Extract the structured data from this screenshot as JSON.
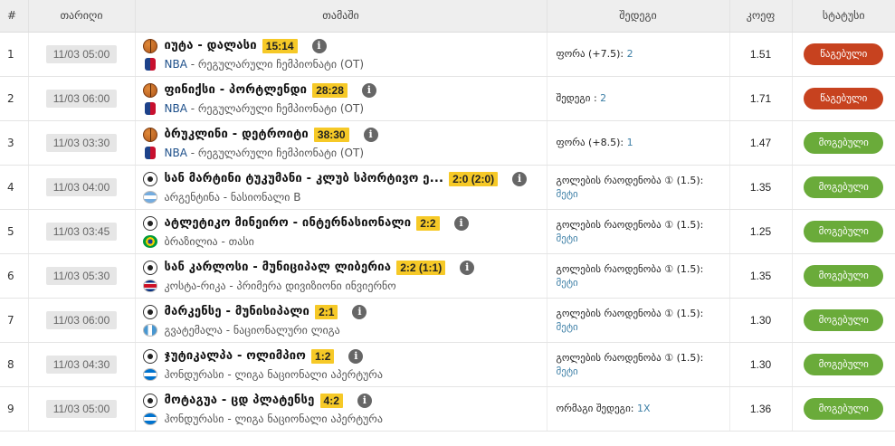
{
  "header": {
    "num": "#",
    "date": "თარიღი",
    "match": "თამაში",
    "result": "შედეგი",
    "coef": "კოეფ",
    "status": "სტატუსი"
  },
  "rows": [
    {
      "num": "1",
      "date": "11/03 05:00",
      "sport": "basketball",
      "teams": "იუტა - დალასი",
      "score": "15:14",
      "flag": "nba",
      "league_prefix": "NBA",
      "league": " - რეგულარული ჩემპიონატი (OT)",
      "result_label": "ფორა (+7.5): ",
      "result_value": "2",
      "result_label2": "",
      "coef": "1.51",
      "status": "წაგებული",
      "status_type": "lost"
    },
    {
      "num": "2",
      "date": "11/03 06:00",
      "sport": "basketball",
      "teams": "ფინიქსი - პორტლენდი",
      "score": "28:28",
      "flag": "nba",
      "league_prefix": "NBA",
      "league": " - რეგულარული ჩემპიონატი (OT)",
      "result_label": "შედეგი : ",
      "result_value": "2",
      "result_label2": "",
      "coef": "1.71",
      "status": "წაგებული",
      "status_type": "lost"
    },
    {
      "num": "3",
      "date": "11/03 03:30",
      "sport": "basketball",
      "teams": "ბრუკლინი - დეტროიტი",
      "score": "38:30",
      "flag": "nba",
      "league_prefix": "NBA",
      "league": " - რეგულარული ჩემპიონატი (OT)",
      "result_label": "ფორა (+8.5): ",
      "result_value": "1",
      "result_label2": "",
      "coef": "1.47",
      "status": "მოგებული",
      "status_type": "won"
    },
    {
      "num": "4",
      "date": "11/03 04:00",
      "sport": "soccer",
      "teams": "სან მარტინი ტუკუმანი - კლუბ სპორტივო ე...",
      "score": "2:0 (2:0)",
      "flag": "ar",
      "league_prefix": "",
      "league": "არგენტინა - ნასიონალი B",
      "result_label": "გოლების რაოდენობა ① (1.5):",
      "result_value": "მეტი",
      "result_label2": "",
      "coef": "1.35",
      "status": "მოგებული",
      "status_type": "won"
    },
    {
      "num": "5",
      "date": "11/03 03:45",
      "sport": "soccer",
      "teams": "ატლეტიკო მინეირო - ინტერნასიონალი",
      "score": "2:2",
      "flag": "br",
      "league_prefix": "",
      "league": "ბრაზილია - თასი",
      "result_label": "გოლების რაოდენობა ① (1.5):",
      "result_value": "მეტი",
      "result_label2": "",
      "coef": "1.25",
      "status": "მოგებული",
      "status_type": "won"
    },
    {
      "num": "6",
      "date": "11/03 05:30",
      "sport": "soccer",
      "teams": "სან კარლოსი - მუნიციპალ ლიბერია",
      "score": "2:2 (1:1)",
      "flag": "cr",
      "league_prefix": "",
      "league": "კოსტა-რიკა - პრიმერა დივიზიონი ინვიერნო",
      "result_label": "გოლების რაოდენობა ① (1.5):",
      "result_value": "მეტი",
      "result_label2": "",
      "coef": "1.35",
      "status": "მოგებული",
      "status_type": "won"
    },
    {
      "num": "7",
      "date": "11/03 06:00",
      "sport": "soccer",
      "teams": "მარკენსე - მუნისიპალი",
      "score": "2:1",
      "flag": "gt",
      "league_prefix": "",
      "league": "გვატემალა - ნაციონალური ლიგა",
      "result_label": "გოლების რაოდენობა ① (1.5):",
      "result_value": "მეტი",
      "result_label2": "",
      "coef": "1.30",
      "status": "მოგებული",
      "status_type": "won"
    },
    {
      "num": "8",
      "date": "11/03 04:30",
      "sport": "soccer",
      "teams": "ჯუტიკალპა - ოლიმპიო",
      "score": "1:2",
      "flag": "hn",
      "league_prefix": "",
      "league": "ჰონდურასი - ლიგა ნაციონალი აპერტურა",
      "result_label": "გოლების რაოდენობა ① (1.5):",
      "result_value": "მეტი",
      "result_label2": "",
      "coef": "1.30",
      "status": "მოგებული",
      "status_type": "won"
    },
    {
      "num": "9",
      "date": "11/03 05:00",
      "sport": "soccer",
      "teams": "მოტაგუა - ცდ პლატენსე",
      "score": "4:2",
      "flag": "hn",
      "league_prefix": "",
      "league": "ჰონდურასი - ლიგა ნაციონალი აპერტურა",
      "result_label": "ორმაგი შედეგი: ",
      "result_value": "1X",
      "result_label2": "",
      "coef": "1.36",
      "status": "მოგებული",
      "status_type": "won"
    }
  ],
  "icons": {
    "info": "info-icon",
    "basketball": "basketball-icon",
    "soccer": "soccer-ball-icon"
  },
  "colors": {
    "lost": "#c7421f",
    "won": "#6aab3a",
    "score_bg": "#f6c927",
    "result_value": "#3d7fa6"
  }
}
